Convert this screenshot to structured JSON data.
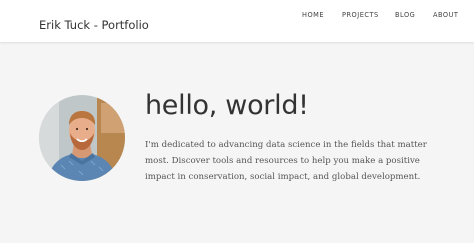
{
  "header": {
    "brand": "Erik Tuck - Portfolio",
    "nav": [
      {
        "label": "HOME"
      },
      {
        "label": "PROJECTS"
      },
      {
        "label": "BLOG"
      },
      {
        "label": "ABOUT"
      }
    ]
  },
  "hero": {
    "title": "hello, world!",
    "line1": "I'm dedicated to advancing data science in the fields that matter",
    "line2": "most. Discover tools and resources to help you make a positive",
    "line3": "impact in conservation, social impact, and global development.",
    "avatar_icon": "profile-photo"
  }
}
